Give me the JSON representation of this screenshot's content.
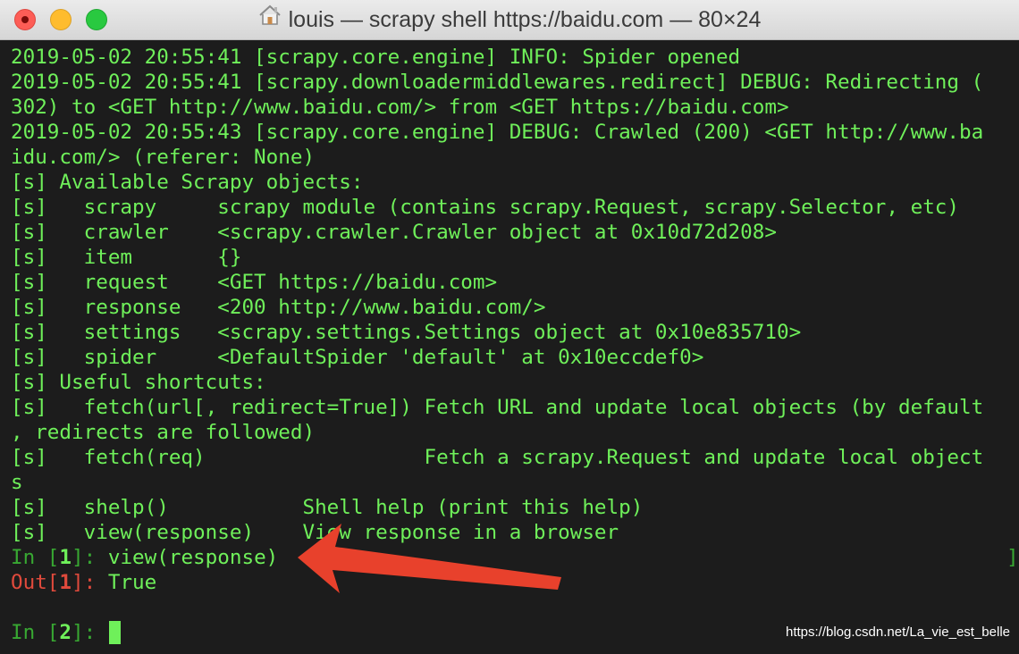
{
  "window": {
    "title": "louis — scrapy shell https://baidu.com — 80×24",
    "traffic_lights": [
      "close",
      "minimize",
      "maximize"
    ]
  },
  "terminal": {
    "lines": [
      "2019-05-02 20:55:41 [scrapy.core.engine] INFO: Spider opened",
      "2019-05-02 20:55:41 [scrapy.downloadermiddlewares.redirect] DEBUG: Redirecting (",
      "302) to <GET http://www.baidu.com/> from <GET https://baidu.com>",
      "2019-05-02 20:55:43 [scrapy.core.engine] DEBUG: Crawled (200) <GET http://www.ba",
      "idu.com/> (referer: None)",
      "[s] Available Scrapy objects:",
      "[s]   scrapy     scrapy module (contains scrapy.Request, scrapy.Selector, etc)",
      "[s]   crawler    <scrapy.crawler.Crawler object at 0x10d72d208>",
      "[s]   item       {}",
      "[s]   request    <GET https://baidu.com>",
      "[s]   response   <200 http://www.baidu.com/>",
      "[s]   settings   <scrapy.settings.Settings object at 0x10e835710>",
      "[s]   spider     <DefaultSpider 'default' at 0x10eccdef0>",
      "[s] Useful shortcuts:",
      "[s]   fetch(url[, redirect=True]) Fetch URL and update local objects (by default",
      ", redirects are followed)",
      "[s]   fetch(req)                  Fetch a scrapy.Request and update local object",
      "s",
      "[s]   shelp()           Shell help (print this help)",
      "[s]   view(response)    View response in a browser"
    ],
    "prompt_in_1": {
      "prefix": "In [",
      "num": "1",
      "suffix": "]: ",
      "command": "view(response)"
    },
    "prompt_out_1": {
      "prefix": "Out[",
      "num": "1",
      "suffix": "]: ",
      "result": "True"
    },
    "prompt_in_2": {
      "prefix": "In [",
      "num": "2",
      "suffix": "]: "
    },
    "right_bracket": "]"
  },
  "watermark": "https://blog.csdn.net/La_vie_est_belle",
  "colors": {
    "background": "#1c1c1c",
    "text_green": "#6ff05a",
    "prompt_dim_green": "#38a832",
    "out_red": "#e04a3c",
    "arrow_red": "#e8412c"
  },
  "icons": {
    "title_icon": "home-icon",
    "annotation": "red-arrow"
  }
}
